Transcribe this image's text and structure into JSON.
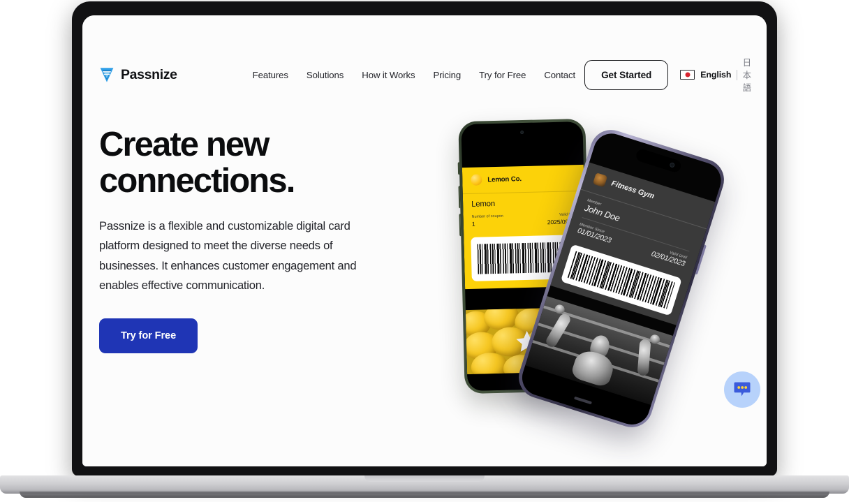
{
  "brand": {
    "name": "Passnize",
    "logo_icon": "passnize-triangle-logo",
    "accent_blue": "#1f35b5",
    "logo_blue": "#2f9fe8"
  },
  "nav": {
    "items": [
      {
        "label": "Features"
      },
      {
        "label": "Solutions"
      },
      {
        "label": "How it Works"
      },
      {
        "label": "Pricing"
      },
      {
        "label": "Try for Free"
      },
      {
        "label": "Contact"
      }
    ]
  },
  "header": {
    "get_started_label": "Get Started",
    "language": {
      "flag_icon": "flag-japan-icon",
      "current": "English",
      "divider": "|",
      "alternate": "日本語"
    }
  },
  "hero": {
    "title": "Create new\nconnections.",
    "subtitle": "Passnize is a flexible and customizable digital card platform designed to meet the diverse needs of businesses. It enhances customer engagement and enables effective communication.",
    "cta_label": "Try for Free"
  },
  "phones": {
    "coupon_card": {
      "device_color": "#3c4b36",
      "card_color": "#fcd209",
      "brand_logo_icon": "lemon-logo-icon",
      "brand_name": "Lemon Co.",
      "product_name": "Lemon",
      "count_label": "Number of coupon",
      "count_value": "1",
      "valid_label": "Valid Until",
      "valid_value": "2025/09/06",
      "barcode_icon": "barcode-1d-icon",
      "photo_icon": "lemons-photo",
      "overlay_icon": "star-icon"
    },
    "membership_card": {
      "device_color": "#55516f",
      "card_color": "#3a3a3a",
      "brand_logo_icon": "gym-logo-icon",
      "brand_name": "Fitness Gym",
      "member_label": "Member",
      "member_value": "John Doe",
      "since_label": "Member Since",
      "since_value": "01/01/2023",
      "valid_label": "Valid Until",
      "valid_value": "02/01/2023",
      "barcode_icon": "barcode-2d-icon",
      "photo_icon": "weightlifter-photo"
    }
  },
  "chat_widget": {
    "icon": "chat-bubble-icon",
    "bubble_color": "#3b5bdb",
    "circle_color": "#b7d2fb",
    "dot_color": "#ffd43b"
  }
}
